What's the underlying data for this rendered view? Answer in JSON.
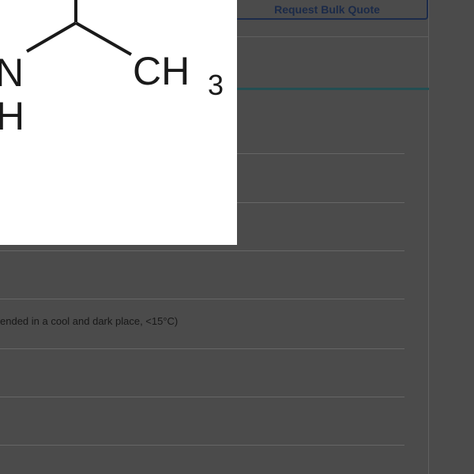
{
  "actions": {
    "bulk_quote_label": "Request Bulk Quote"
  },
  "structure": {
    "atoms": {
      "n": "N",
      "h": "H",
      "ch": "CH",
      "sub": "3"
    }
  },
  "details": {
    "storage_text": "ended in a cool and dark place, <15°C)"
  },
  "colors": {
    "button_border": "#1c2b4a",
    "tab_underline": "#234e52",
    "background": "#4b4b4b"
  }
}
